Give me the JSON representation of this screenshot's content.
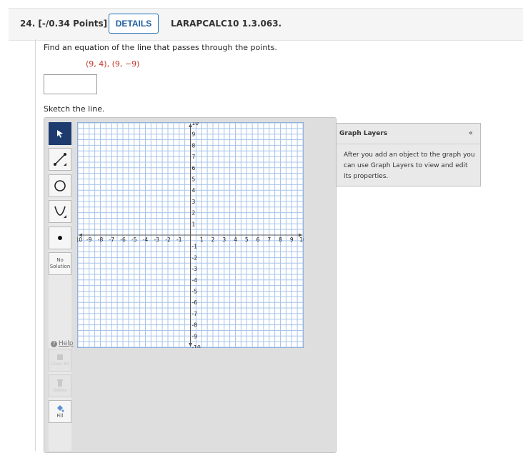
{
  "question": {
    "number_label": "24.  [-/0.34 Points]",
    "details_button": "DETAILS",
    "code": "LARAPCALC10 1.3.063.",
    "prompt": "Find an equation of the line that passes through the points.",
    "points": "(9, 4), (9, −9)",
    "answer_value": "",
    "sketch_label": "Sketch the line."
  },
  "toolbar": {
    "no_solution_label": "No\nSolution",
    "help_label": "Help",
    "clear_all_label": "Clear All",
    "delete_label": "Delete",
    "fill_label": "Fill",
    "icons": [
      "pointer-icon",
      "line-icon",
      "circle-icon",
      "parabola-icon",
      "point-icon",
      "clear-all-icon",
      "trash-icon",
      "fill-icon"
    ]
  },
  "graph": {
    "x_tick_labels": [
      "-10",
      "-9",
      "-8",
      "-7",
      "-6",
      "-5",
      "-4",
      "-3",
      "-2",
      "-1",
      "1",
      "2",
      "3",
      "4",
      "5",
      "6",
      "7",
      "8",
      "9",
      "10"
    ],
    "y_tick_labels": [
      "10",
      "9",
      "8",
      "7",
      "6",
      "5",
      "4",
      "3",
      "2",
      "1",
      "-1",
      "-2",
      "-3",
      "-4",
      "-5",
      "-6",
      "-7",
      "-8",
      "-9",
      "-10"
    ],
    "xlim": [
      -10,
      10
    ],
    "ylim": [
      -10,
      10
    ],
    "grid": true,
    "grid_color": "#a8c4ea",
    "axis_color": "#555555"
  },
  "graph_layers": {
    "title": "Graph Layers",
    "collapse_symbol": "«",
    "message": "After you add an object to the graph you can use Graph Layers to view and edit its properties."
  },
  "colors": {
    "accent": "#1f6fb5",
    "points_red": "#c0392b",
    "selected_tool": "#1d3b6e"
  }
}
